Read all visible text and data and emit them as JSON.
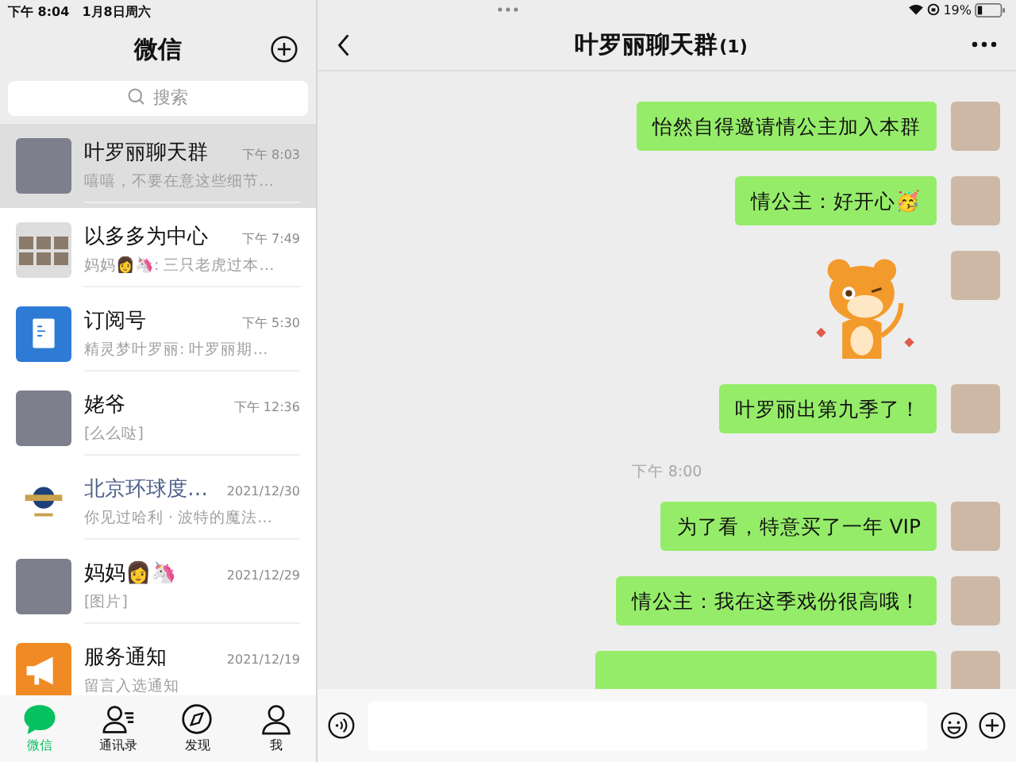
{
  "status_bar": {
    "time": "下午 8:04",
    "date": "1月8日周六",
    "battery": "19%"
  },
  "sidebar": {
    "title": "微信",
    "search": {
      "placeholder": "搜索"
    },
    "chats": [
      {
        "name": "叶罗丽聊天群",
        "preview": "嘻嘻，不要在意这些细节…",
        "time": "下午 8:03",
        "kind": "photo",
        "selected": true
      },
      {
        "name": "以多多为中心",
        "preview": "妈妈👩🦄: 三只老虎过本…",
        "time": "下午 7:49",
        "kind": "group",
        "selected": false
      },
      {
        "name": "订阅号",
        "preview": "精灵梦叶罗丽: 叶罗丽期…",
        "time": "下午 5:30",
        "kind": "subscription",
        "selected": false
      },
      {
        "name": "姥爷",
        "preview": "[么么哒]",
        "time": "下午 12:36",
        "kind": "photo",
        "selected": false
      },
      {
        "name": "北京环球度…",
        "preview": "你见过哈利 · 波特的魔法…",
        "time": "2021/12/30",
        "kind": "official",
        "selected": false
      },
      {
        "name": "妈妈👩🦄",
        "preview": "[图片]",
        "time": "2021/12/29",
        "kind": "photo",
        "selected": false
      },
      {
        "name": "服务通知",
        "preview": "留言入选通知",
        "time": "2021/12/19",
        "kind": "service",
        "selected": false
      }
    ],
    "tabs": [
      {
        "label": "微信",
        "selected": true
      },
      {
        "label": "通讯录",
        "selected": false
      },
      {
        "label": "发现",
        "selected": false
      },
      {
        "label": "我",
        "selected": false
      }
    ]
  },
  "chat": {
    "title": "叶罗丽聊天群",
    "unread": "(1)",
    "messages": [
      {
        "kind": "text",
        "text": "怡然自得邀请情公主加入本群"
      },
      {
        "kind": "text",
        "text": "情公主：好开心🥳"
      },
      {
        "kind": "sticker"
      },
      {
        "kind": "text",
        "text": "叶罗丽出第九季了！"
      },
      {
        "kind": "time",
        "text": "下午 8:00"
      },
      {
        "kind": "text",
        "text": "为了看，特意买了一年 VIP"
      },
      {
        "kind": "text",
        "text": "情公主：我在这季戏份很高哦！"
      },
      {
        "kind": "cut"
      }
    ]
  }
}
